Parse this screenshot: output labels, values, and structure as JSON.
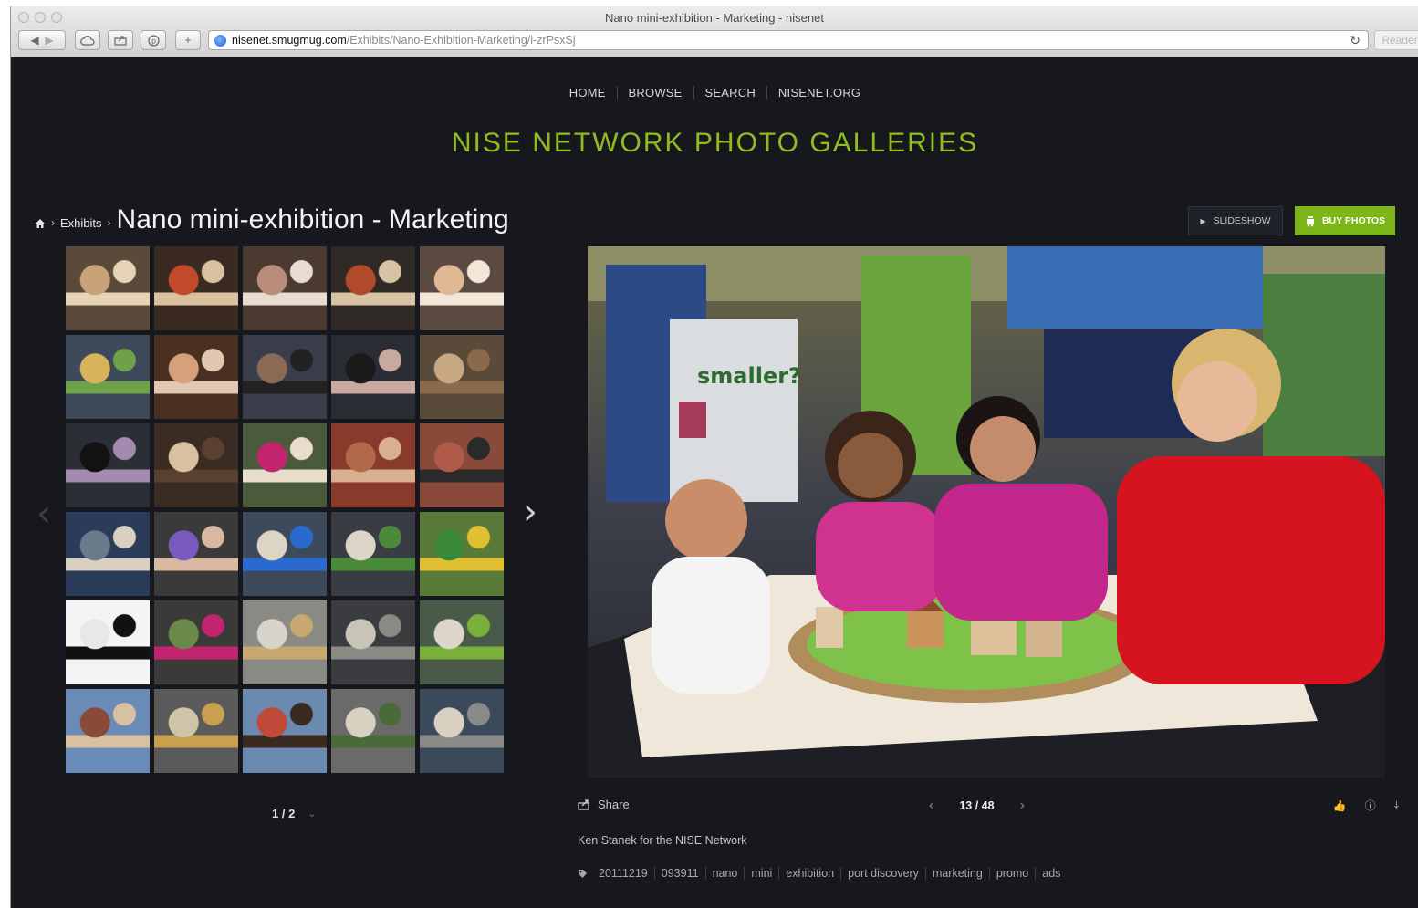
{
  "browser": {
    "title": "Nano mini-exhibition - Marketing - nisenet",
    "url_host": "nisenet.smugmug.com",
    "url_path": "/Exhibits/Nano-Exhibition-Marketing/i-zrPsxSj",
    "reader_label": "Reader"
  },
  "nav": {
    "items": [
      "HOME",
      "BROWSE",
      "SEARCH",
      "NISENET.ORG"
    ]
  },
  "site_title": "NISE NETWORK PHOTO GALLERIES",
  "breadcrumb": {
    "parent": "Exhibits",
    "title": "Nano mini-exhibition - Marketing"
  },
  "actions": {
    "slideshow": "SLIDESHOW",
    "buy": "BUY PHOTOS"
  },
  "thumbnails": {
    "count": 30,
    "pager": "1 / 2"
  },
  "photo": {
    "share_label": "Share",
    "counter": "13 / 48",
    "caption": "Ken Stanek for the NISE Network",
    "tags": [
      "20111219",
      "093911",
      "nano",
      "mini",
      "exhibition",
      "port discovery",
      "marketing",
      "promo",
      "ads"
    ],
    "sign_text": "smaller?"
  },
  "colors": {
    "accent": "#7cb518",
    "title_green": "#8fbc1f",
    "background": "#17181e"
  }
}
